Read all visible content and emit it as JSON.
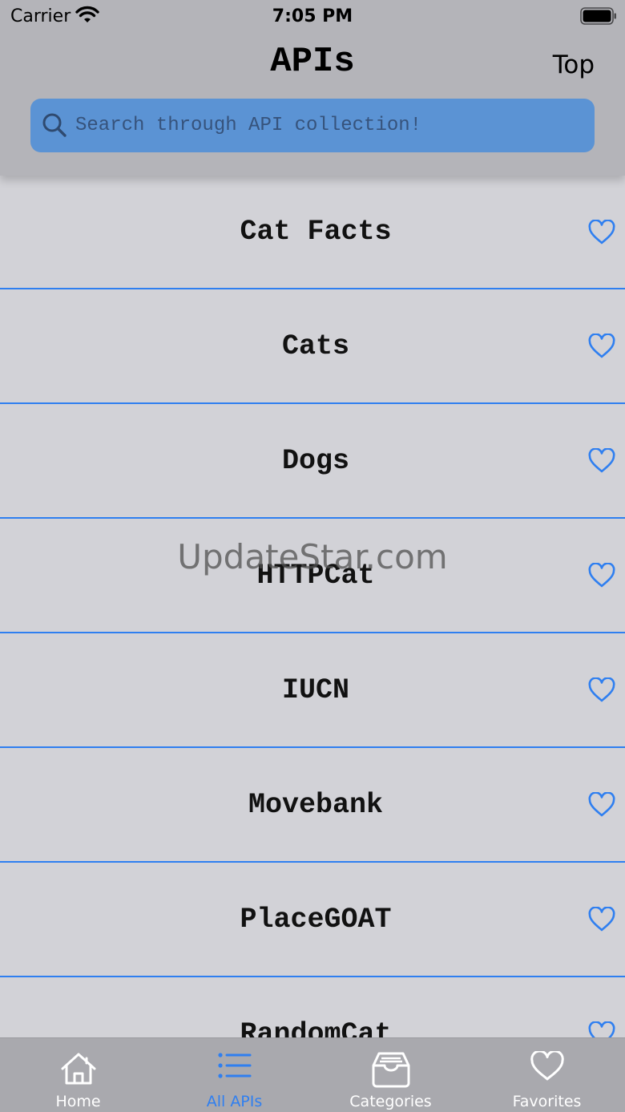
{
  "status_bar": {
    "carrier": "Carrier",
    "time": "7:05 PM"
  },
  "nav": {
    "title": "APIs",
    "top_button": "Top"
  },
  "search": {
    "placeholder": "Search through API collection!"
  },
  "list": {
    "items": [
      {
        "name": "Cat Facts"
      },
      {
        "name": "Cats"
      },
      {
        "name": "Dogs"
      },
      {
        "name": "HTTPCat"
      },
      {
        "name": "IUCN"
      },
      {
        "name": "Movebank"
      },
      {
        "name": "PlaceGOAT"
      },
      {
        "name": "RandomCat"
      }
    ]
  },
  "watermark": "UpdateStar.com",
  "tab_bar": {
    "tabs": [
      {
        "label": "Home",
        "icon": "house-icon",
        "active": false
      },
      {
        "label": "All APIs",
        "icon": "list-icon",
        "active": true
      },
      {
        "label": "Categories",
        "icon": "archive-box-icon",
        "active": false
      },
      {
        "label": "Favorites",
        "icon": "heart-icon",
        "active": false
      }
    ]
  },
  "colors": {
    "accent": "#2f7ff0",
    "search_bg": "#5b93d4",
    "header_bg": "#b4b4b9",
    "list_bg": "#d2d2d7",
    "tabbar_bg": "#a9a9ae"
  }
}
